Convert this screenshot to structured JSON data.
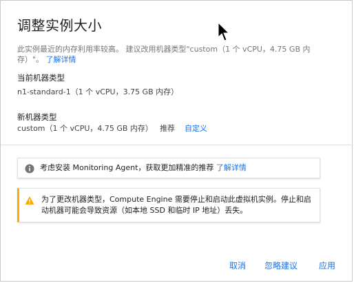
{
  "dialog": {
    "title": "调整实例大小",
    "description": "此实例最近的内存利用率较高。 建议改用机器类型\"custom（1 个 vCPU，4.75 GB 内存）\"。",
    "description_link": "了解详情",
    "current_machine": {
      "label": "当前机器类型",
      "value": "n1-standard-1（1 个 vCPU，3.75 GB 内存）"
    },
    "new_machine": {
      "label": "新机器类型",
      "value": "custom（1 个 vCPU，4.75 GB 内存）",
      "recommend": "推荐",
      "customize_link": "自定义"
    },
    "info_notice": {
      "text": "考虑安装 Monitoring Agent，获取更加精准的推荐",
      "link": "了解详情",
      "icon": "info-icon"
    },
    "warning_notice": {
      "text": "为了更改机器类型，Compute Engine 需要停止和启动此虚拟机实例。停止和启动机器可能会导致资源（如本地 SSD 和临时 IP 地址）丢失。",
      "icon": "warning-icon"
    },
    "actions": {
      "cancel": "取消",
      "ignore": "忽略建议",
      "apply": "应用"
    }
  },
  "colors": {
    "link": "#1a73e8",
    "warning": "#f9ab00",
    "info_icon": "#757575"
  }
}
